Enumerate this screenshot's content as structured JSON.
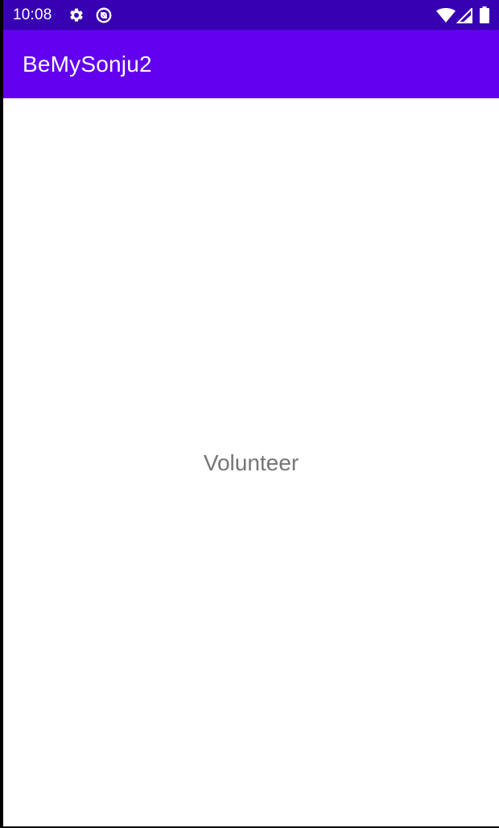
{
  "status_bar": {
    "time": "10:08",
    "icons": [
      "settings-icon",
      "data-saver-icon",
      "wifi-icon",
      "signal-icon",
      "battery-icon"
    ],
    "background": "#3700b3"
  },
  "app_bar": {
    "title": "BeMySonju2",
    "background": "#6200ee"
  },
  "main": {
    "label": "Volunteer",
    "label_color": "#757575"
  }
}
